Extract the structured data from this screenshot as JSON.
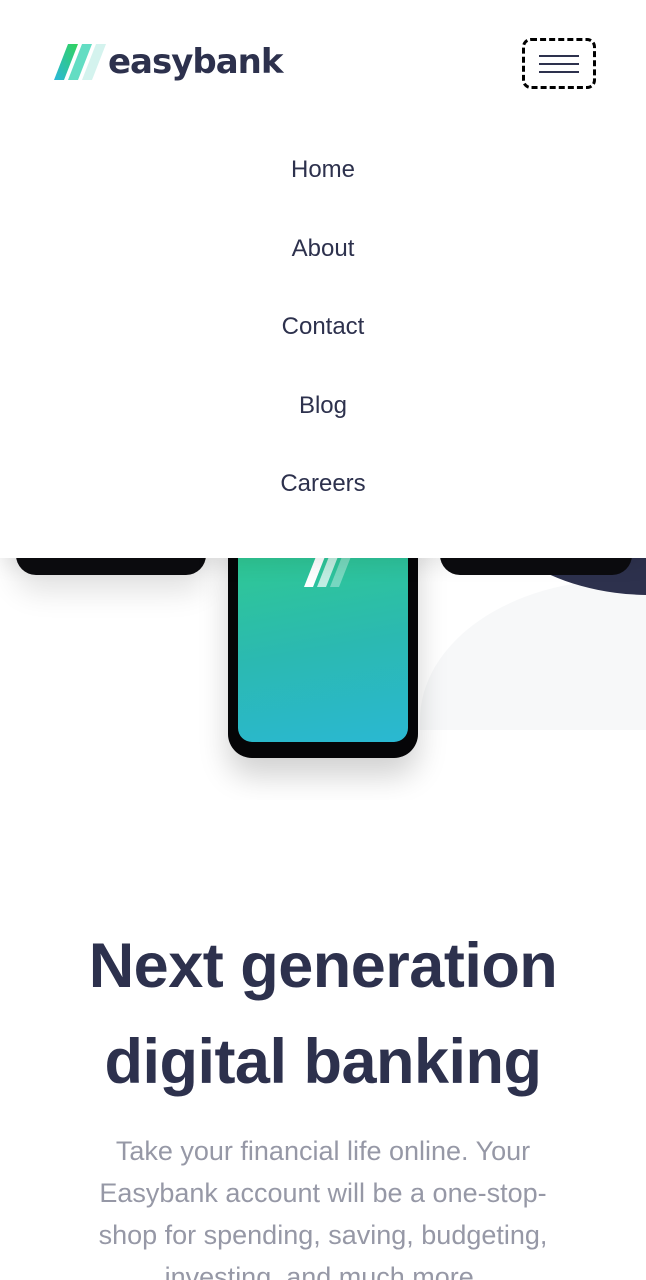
{
  "brand": {
    "name": "easybank",
    "logo_icon": "easybank-logo-icon"
  },
  "header": {
    "menu_button_icon": "hamburger-menu-icon"
  },
  "menu": {
    "items": [
      {
        "label": "Home"
      },
      {
        "label": "About"
      },
      {
        "label": "Contact"
      },
      {
        "label": "Blog"
      },
      {
        "label": "Careers"
      }
    ]
  },
  "hero": {
    "headline_line1": "Next generation",
    "headline_line2": "digital banking",
    "description": "Take your financial life online. Your Easybank account will be a one-stop-shop for spending, saving, budgeting, investing, and much more."
  },
  "colors": {
    "dark_blue": "#2d314d",
    "lime_green": "#31d35c",
    "bright_cyan": "#2bb7da",
    "grayish_blue": "#9698a6",
    "white": "#ffffff"
  }
}
